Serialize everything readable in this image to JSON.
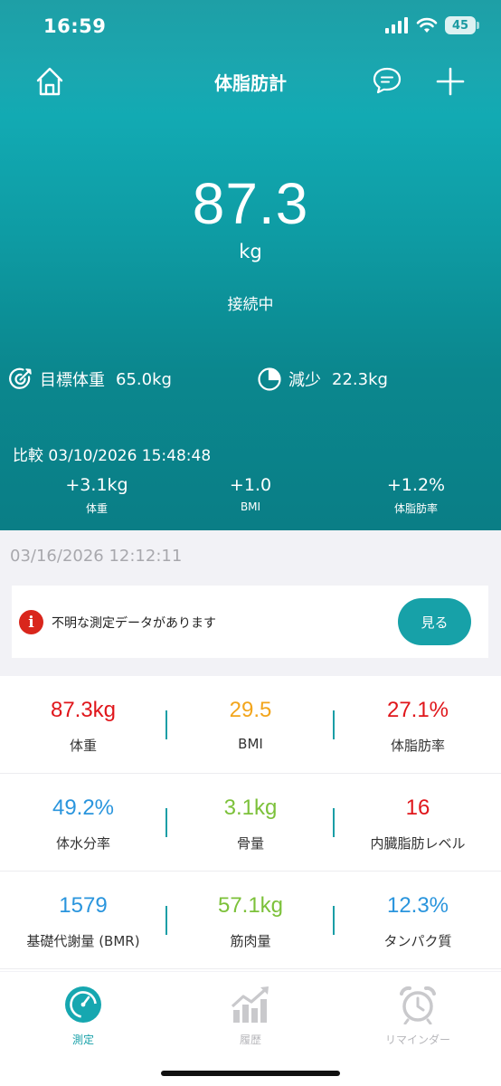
{
  "status_bar": {
    "time": "16:59",
    "battery": "45"
  },
  "nav": {
    "title": "体脂肪計"
  },
  "current": {
    "weight": "87.3",
    "unit": "kg",
    "status": "接続中"
  },
  "goal": {
    "label": "目標体重",
    "value": "65.0kg"
  },
  "loss": {
    "label": "減少",
    "value": "22.3kg"
  },
  "comparison": {
    "title": "比較 03/10/2026 15:48:48",
    "items": [
      {
        "value": "+3.1kg",
        "label": "体重"
      },
      {
        "value": "+1.0",
        "label": "BMI"
      },
      {
        "value": "+1.2%",
        "label": "体脂肪率"
      }
    ]
  },
  "measurement_time": "03/16/2026 12:12:11",
  "notice": {
    "text": "不明な測定データがあります",
    "button": "見る"
  },
  "metrics": [
    [
      {
        "value": "87.3kg",
        "label": "体重",
        "color": "#e0161b"
      },
      {
        "value": "29.5",
        "label": "BMI",
        "color": "#f2a51c"
      },
      {
        "value": "27.1%",
        "label": "体脂肪率",
        "color": "#e0161b"
      }
    ],
    [
      {
        "value": "49.2%",
        "label": "体水分率",
        "color": "#2a95dd"
      },
      {
        "value": "3.1kg",
        "label": "骨量",
        "color": "#7cc13a"
      },
      {
        "value": "16",
        "label": "内臓脂肪レベル",
        "color": "#e0161b"
      }
    ],
    [
      {
        "value": "1579",
        "label": "基礎代謝量 (BMR)",
        "color": "#2a95dd"
      },
      {
        "value": "57.1kg",
        "label": "筋肉量",
        "color": "#7cc13a"
      },
      {
        "value": "12.3%",
        "label": "タンパク質",
        "color": "#2a95dd"
      }
    ]
  ],
  "tabs": [
    {
      "label": "測定",
      "icon": "gauge-icon"
    },
    {
      "label": "履歴",
      "icon": "chart-icon"
    },
    {
      "label": "リマインダー",
      "icon": "alarm-clock-icon"
    }
  ]
}
